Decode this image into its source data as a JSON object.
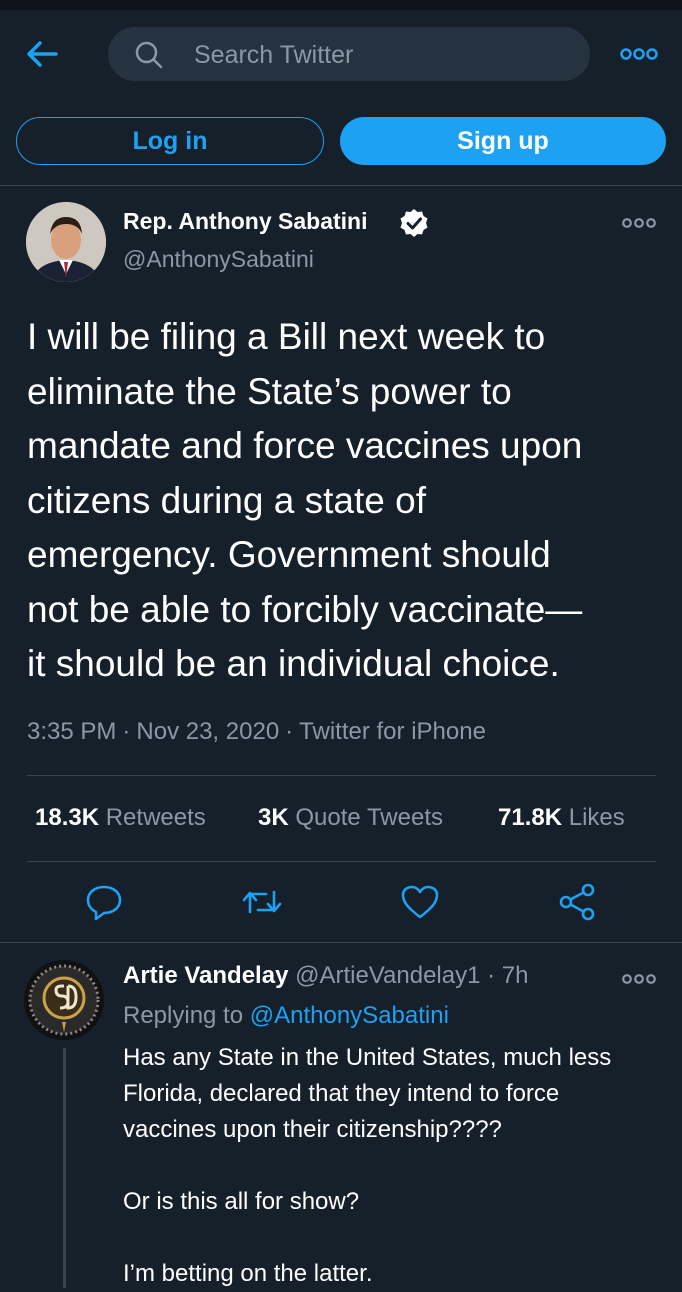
{
  "header": {
    "search_placeholder": "Search Twitter",
    "login_label": "Log in",
    "signup_label": "Sign up"
  },
  "tweet": {
    "author_name": "Rep. Anthony Sabatini",
    "author_handle": "@AnthonySabatini",
    "text": "I will be filing a Bill next week to\neliminate the State’s power to\nmandate and force vaccines upon\ncitizens during a state of\nemergency.  Government should\nnot be able to forcibly vaccinate—\nit should be an individual choice.",
    "time": "3:35 PM",
    "date": "Nov 23, 2020",
    "source": "Twitter for iPhone",
    "stats": {
      "retweets_count": "18.3K",
      "retweets_label": "Retweets",
      "quotes_count": "3K",
      "quotes_label": "Quote Tweets",
      "likes_count": "71.8K",
      "likes_label": "Likes"
    }
  },
  "reply": {
    "author_name": "Artie Vandelay",
    "author_handle": "@ArtieVandelay1",
    "time_ago": "7h",
    "replying_prefix": "Replying to",
    "replying_to": "@AnthonySabatini",
    "lines": [
      "Has any State in the United States, much less Florida, declared that they intend to force vaccines upon their citizenship????",
      "Or is this all for show?",
      "I’m betting on the latter."
    ]
  },
  "colors": {
    "background": "#15202b",
    "accent": "#1da1f2",
    "secondary_text": "#8b98a5",
    "divider": "#38444d"
  },
  "icons": [
    "back-arrow-icon",
    "search-icon",
    "more-icon",
    "verified-icon",
    "reply-icon",
    "retweet-icon",
    "like-icon",
    "share-icon"
  ]
}
